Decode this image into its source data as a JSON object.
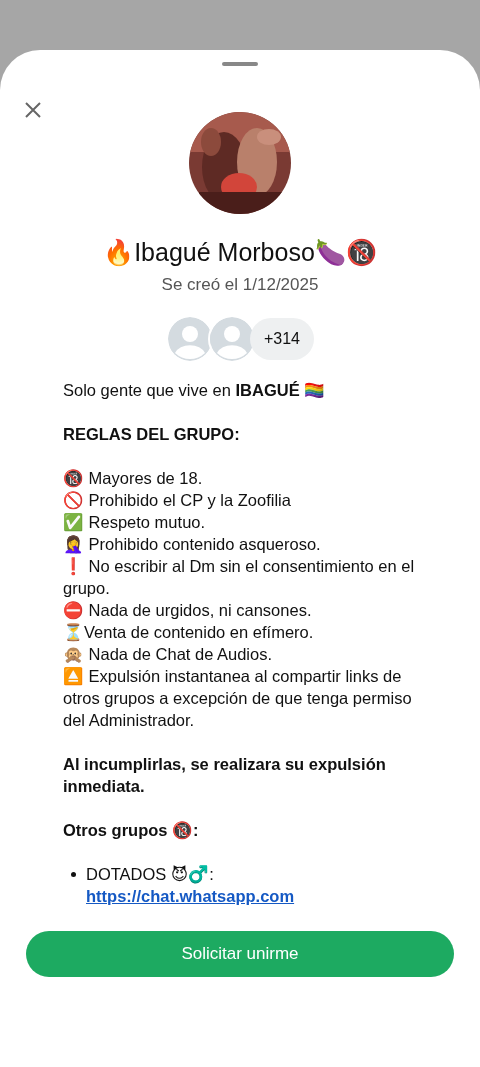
{
  "group": {
    "name": "🔥Ibagué Morboso🍆🔞",
    "created": "Se creó el 1/12/2025",
    "members_more": "+314"
  },
  "description": [
    {
      "kind": "text",
      "text": "Solo gente que vive en **IBAGUÉ** 🏳️‍🌈"
    },
    {
      "kind": "heading",
      "text": "REGLAS DEL GRUPO:"
    },
    {
      "kind": "lines",
      "lines": [
        "🔞 Mayores de 18.",
        "🚫 Prohibido el CP y la Zoofilia",
        "✅ Respeto mutuo.",
        "🤦‍♀️ Prohibido contenido asqueroso.",
        "❗ No escribir al Dm sin el consentimiento en el grupo.",
        "⛔ Nada de urgidos, ni cansones.",
        "⏳Venta de contenido en efímero.",
        "🙊 Nada de Chat de Audios.",
        "⏏️ Expulsión instantanea al compartir links de otros grupos a excepción de que tenga permiso del Administrador."
      ]
    },
    {
      "kind": "heading",
      "text": "Al incumplirlas, se realizara su expulsión inmediata."
    },
    {
      "kind": "heading",
      "text": "Otros grupos 🔞:"
    },
    {
      "kind": "bullet",
      "text": "DOTADOS 😈♂️:",
      "link": "https://chat.whatsapp.com"
    }
  ],
  "button": "Solicitar unirme"
}
